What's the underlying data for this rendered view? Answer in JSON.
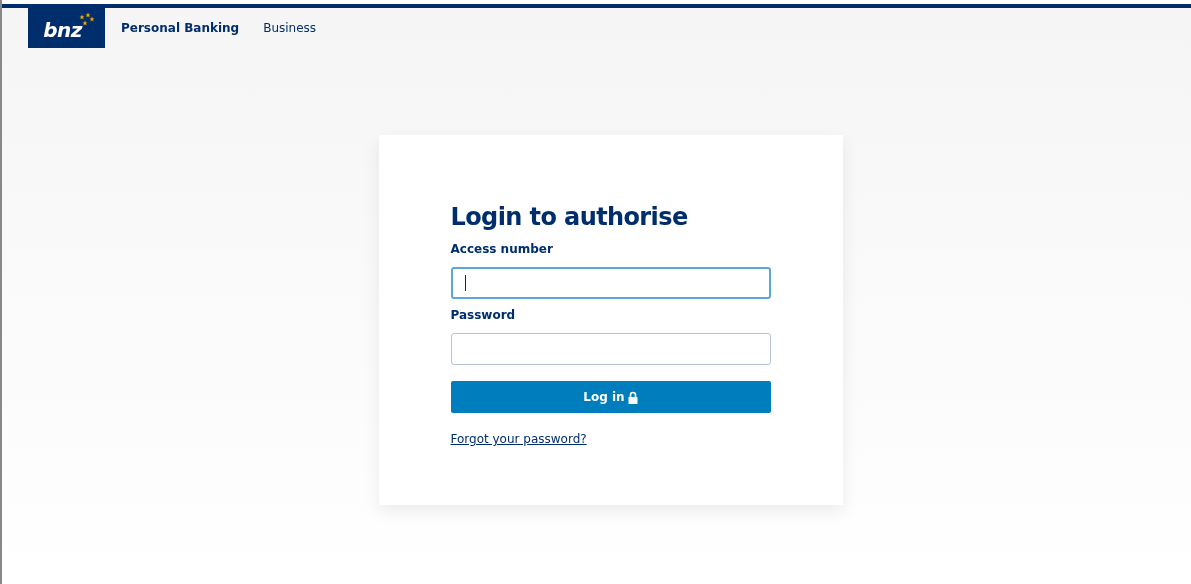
{
  "header": {
    "logo": "bnz",
    "nav": [
      {
        "label": "Personal Banking",
        "selected": true
      },
      {
        "label": "Business",
        "selected": false
      }
    ]
  },
  "login": {
    "title": "Login to authorise",
    "fields": [
      {
        "label": "Access number",
        "focused": true
      },
      {
        "label": "Password",
        "focused": false
      }
    ],
    "button": "Log in",
    "link": "Forgot your password?"
  }
}
